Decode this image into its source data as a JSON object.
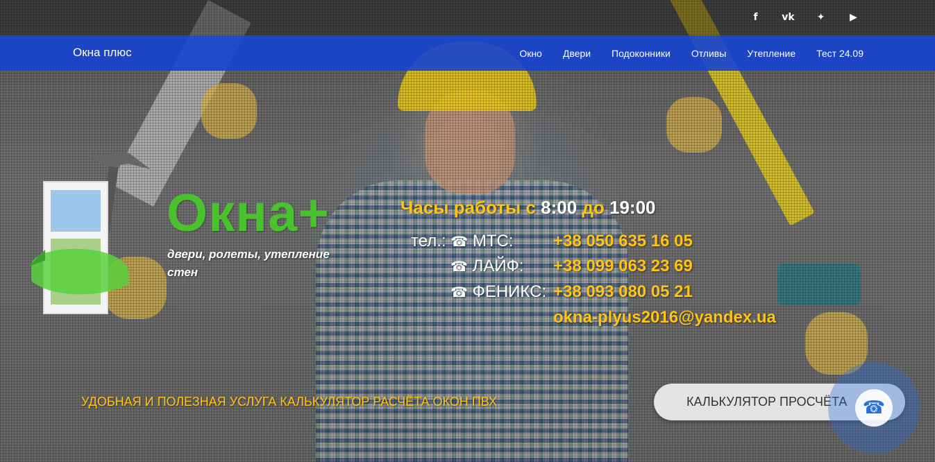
{
  "social": {
    "facebook": "f",
    "vk": "vk",
    "twitter": "✦",
    "youtube": "▶"
  },
  "navbar": {
    "brand": "Окна плюс",
    "menu": [
      "Окно",
      "Двери",
      "Подоконники",
      "Отливы",
      "Утепление",
      "Тест 24.09"
    ]
  },
  "logo": {
    "title": "Окна+",
    "subtitle": "двери, ролеты, утепление стен"
  },
  "contacts": {
    "hours_prefix": "Часы работы с ",
    "hours_from": "8:00",
    "hours_mid": " до ",
    "hours_to": "19:00",
    "tel_label": "тел.:",
    "rows": [
      {
        "label": "МТС:",
        "number": "+38 050 635 16 05"
      },
      {
        "label": "ЛАЙФ:",
        "number": "+38 099 063 23 69"
      },
      {
        "label": "ФЕНИКС:",
        "number": "+38 093 080 05 21"
      }
    ],
    "email": "okna-plyus2016@yandex.ua",
    "phone_glyph": "☎"
  },
  "promo": {
    "tagline": "УДОБНАЯ И ПОЛЕЗНАЯ УСЛУГА КАЛЬКУЛЯТОР РАСЧЁТА ОКОН ПВХ",
    "button": "КАЛЬКУЛЯТОР ПРОСЧЁТА"
  },
  "colors": {
    "accent_yellow": "#ffc315",
    "brand_green": "#49c22e",
    "navbar_blue": "#1644d2"
  }
}
